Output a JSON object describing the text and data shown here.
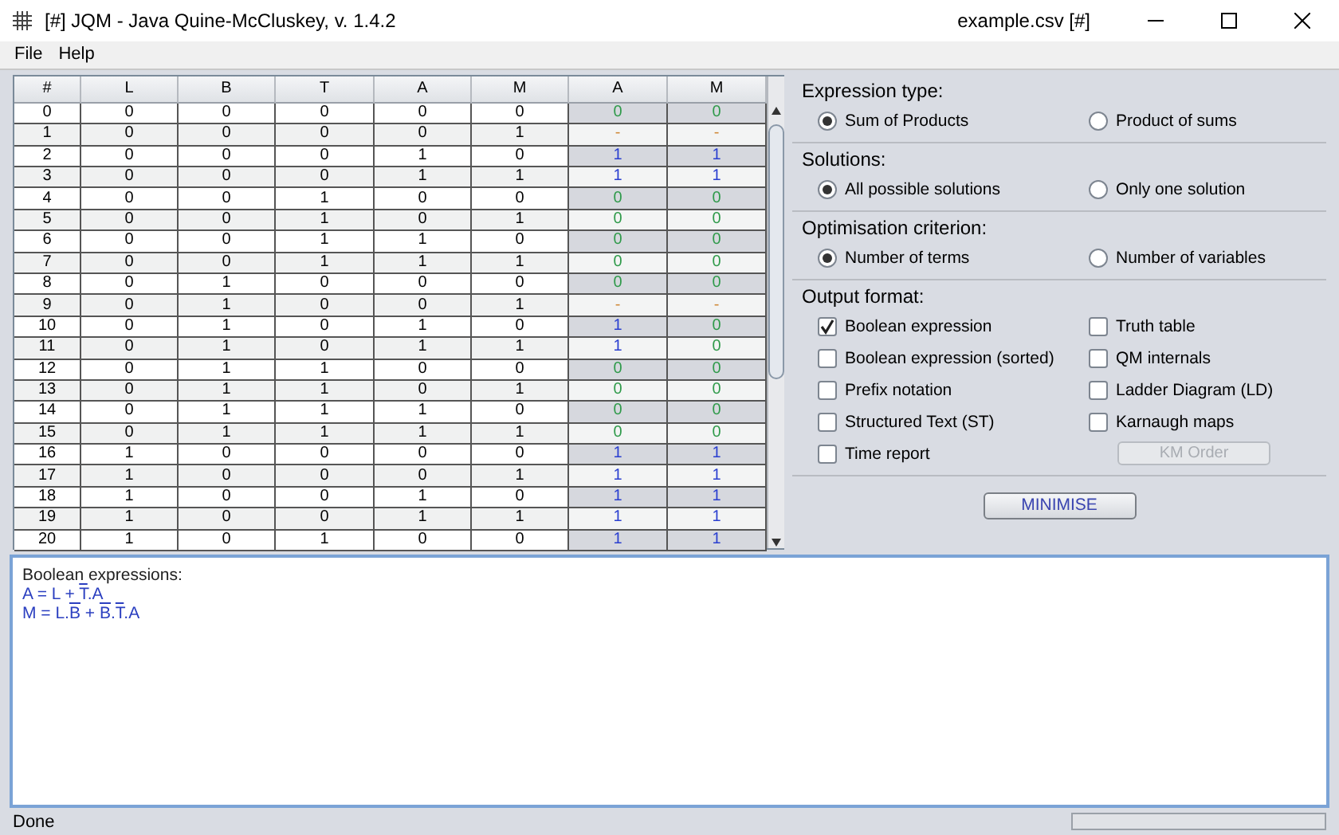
{
  "window": {
    "title": "[#] JQM - Java Quine-McCluskey, v. 1.4.2",
    "file": "example.csv [#]"
  },
  "menu": [
    "File",
    "Help"
  ],
  "table": {
    "columns": [
      {
        "label": "#",
        "kind": "index"
      },
      {
        "label": "L",
        "kind": "input"
      },
      {
        "label": "B",
        "kind": "input"
      },
      {
        "label": "T",
        "kind": "input"
      },
      {
        "label": "A",
        "kind": "input"
      },
      {
        "label": "M",
        "kind": "input"
      },
      {
        "label": "A",
        "kind": "output"
      },
      {
        "label": "M",
        "kind": "output"
      }
    ],
    "rows": [
      [
        "0",
        "0",
        "0",
        "0",
        "0",
        "0",
        "0",
        "0"
      ],
      [
        "1",
        "0",
        "0",
        "0",
        "0",
        "1",
        "-",
        "-"
      ],
      [
        "2",
        "0",
        "0",
        "0",
        "1",
        "0",
        "1",
        "1"
      ],
      [
        "3",
        "0",
        "0",
        "0",
        "1",
        "1",
        "1",
        "1"
      ],
      [
        "4",
        "0",
        "0",
        "1",
        "0",
        "0",
        "0",
        "0"
      ],
      [
        "5",
        "0",
        "0",
        "1",
        "0",
        "1",
        "0",
        "0"
      ],
      [
        "6",
        "0",
        "0",
        "1",
        "1",
        "0",
        "0",
        "0"
      ],
      [
        "7",
        "0",
        "0",
        "1",
        "1",
        "1",
        "0",
        "0"
      ],
      [
        "8",
        "0",
        "1",
        "0",
        "0",
        "0",
        "0",
        "0"
      ],
      [
        "9",
        "0",
        "1",
        "0",
        "0",
        "1",
        "-",
        "-"
      ],
      [
        "10",
        "0",
        "1",
        "0",
        "1",
        "0",
        "1",
        "0"
      ],
      [
        "11",
        "0",
        "1",
        "0",
        "1",
        "1",
        "1",
        "0"
      ],
      [
        "12",
        "0",
        "1",
        "1",
        "0",
        "0",
        "0",
        "0"
      ],
      [
        "13",
        "0",
        "1",
        "1",
        "0",
        "1",
        "0",
        "0"
      ],
      [
        "14",
        "0",
        "1",
        "1",
        "1",
        "0",
        "0",
        "0"
      ],
      [
        "15",
        "0",
        "1",
        "1",
        "1",
        "1",
        "0",
        "0"
      ],
      [
        "16",
        "1",
        "0",
        "0",
        "0",
        "0",
        "1",
        "1"
      ],
      [
        "17",
        "1",
        "0",
        "0",
        "0",
        "1",
        "1",
        "1"
      ],
      [
        "18",
        "1",
        "0",
        "0",
        "1",
        "0",
        "1",
        "1"
      ],
      [
        "19",
        "1",
        "0",
        "0",
        "1",
        "1",
        "1",
        "1"
      ],
      [
        "20",
        "1",
        "0",
        "1",
        "0",
        "0",
        "1",
        "1"
      ]
    ]
  },
  "option_groups": [
    {
      "title": "Expression type:",
      "options": [
        {
          "label": "Sum of Products",
          "selected": true
        },
        {
          "label": "Product of sums",
          "selected": false
        }
      ]
    },
    {
      "title": "Solutions:",
      "options": [
        {
          "label": "All possible solutions",
          "selected": true
        },
        {
          "label": "Only one solution",
          "selected": false
        }
      ]
    },
    {
      "title": "Optimisation criterion:",
      "options": [
        {
          "label": "Number of terms",
          "selected": true
        },
        {
          "label": "Number of variables",
          "selected": false
        }
      ]
    }
  ],
  "output_format": {
    "title": "Output format:",
    "items": [
      {
        "kind": "checkbox",
        "label": "Boolean expression",
        "checked": true
      },
      {
        "kind": "checkbox",
        "label": "Truth table",
        "checked": false
      },
      {
        "kind": "checkbox",
        "label": "Boolean expression (sorted)",
        "checked": false
      },
      {
        "kind": "checkbox",
        "label": "QM internals",
        "checked": false
      },
      {
        "kind": "checkbox",
        "label": "Prefix notation",
        "checked": false
      },
      {
        "kind": "checkbox",
        "label": "Ladder Diagram (LD)",
        "checked": false
      },
      {
        "kind": "checkbox",
        "label": "Structured Text (ST)",
        "checked": false
      },
      {
        "kind": "checkbox",
        "label": "Karnaugh maps",
        "checked": false
      },
      {
        "kind": "checkbox",
        "label": "Time report",
        "checked": false
      },
      {
        "kind": "button",
        "label": "KM Order",
        "disabled": true
      }
    ]
  },
  "minimise_button": "MINIMISE",
  "result": {
    "heading": "Boolean expressions:",
    "expressions": [
      [
        {
          "text": "A = L + "
        },
        {
          "text": "T",
          "negated": true
        },
        {
          "text": ".A"
        }
      ],
      [
        {
          "text": "M = L."
        },
        {
          "text": "B",
          "negated": true
        },
        {
          "text": " + "
        },
        {
          "text": "B",
          "negated": true
        },
        {
          "text": "."
        },
        {
          "text": "T",
          "negated": true
        },
        {
          "text": ".A"
        }
      ]
    ]
  },
  "status_bar": {
    "text": "Done"
  }
}
